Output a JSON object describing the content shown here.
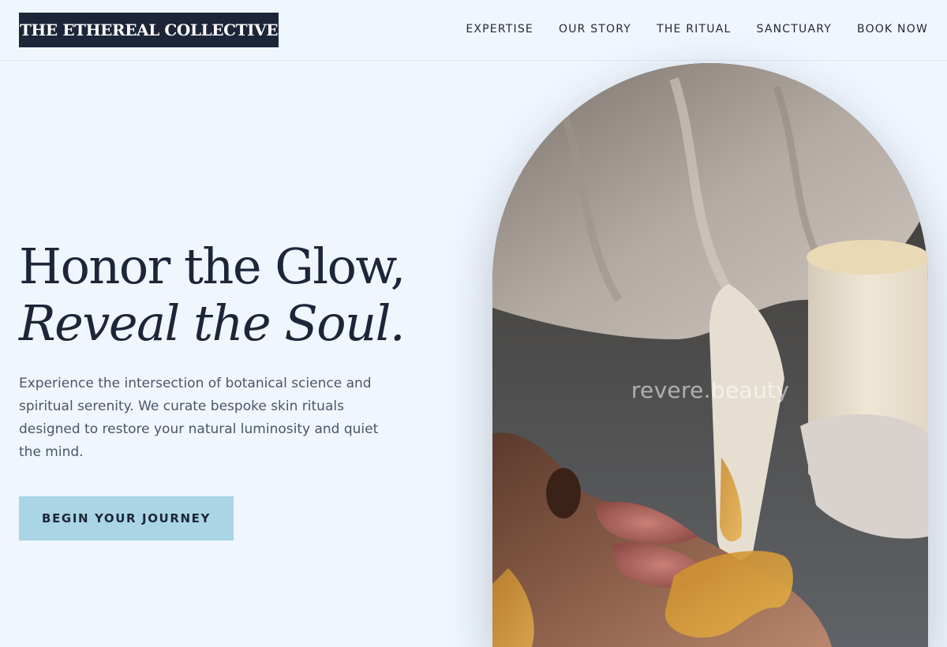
{
  "brand": {
    "name": "THE ETHEREAL COLLECTIVE"
  },
  "nav": {
    "items": [
      {
        "label": "EXPERTISE"
      },
      {
        "label": "OUR STORY"
      },
      {
        "label": "THE RITUAL"
      },
      {
        "label": "SANCTUARY"
      },
      {
        "label": "BOOK NOW"
      }
    ]
  },
  "hero": {
    "title_line1": "Honor the Glow,",
    "title_line2": "Reveal the Soul.",
    "description": "Experience the intersection of botanical science and spiritual serenity. We curate bespoke skin rituals designed to restore your natural luminosity and quiet the mind.",
    "cta_label": "BEGIN YOUR JOURNEY",
    "image_watermark": "revere.beauty"
  },
  "colors": {
    "background": "#eff6fe",
    "navy": "#1c2638",
    "accent": "#a9d5e5",
    "body_text": "#4a5568"
  }
}
